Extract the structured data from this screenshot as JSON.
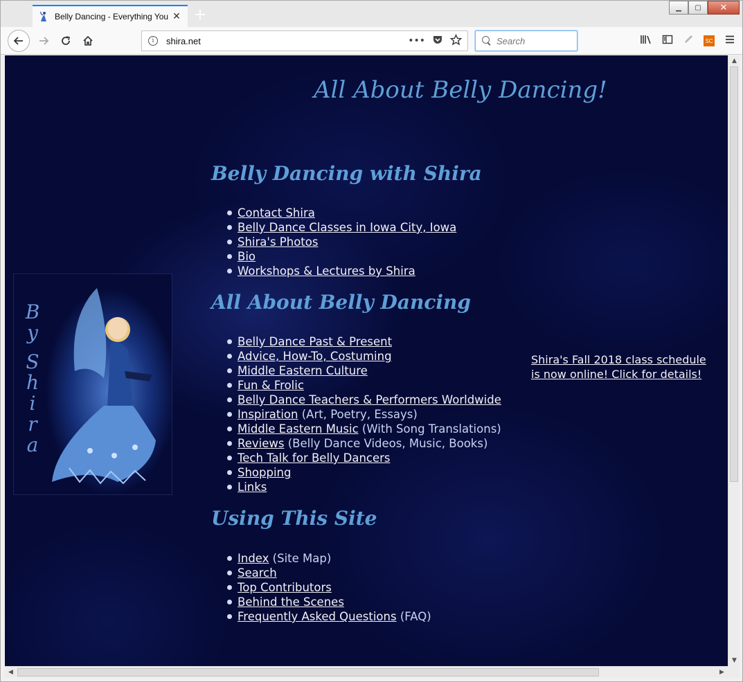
{
  "browser": {
    "tab_title": "Belly Dancing - Everything You",
    "tab_close": "✕",
    "new_tab": "+",
    "url": "shira.net",
    "search_placeholder": "Search",
    "page_actions": "•••",
    "sc_badge": "SC",
    "window_controls": {
      "minimize": "▁",
      "maximize": "▢",
      "close": "✕"
    }
  },
  "page": {
    "title": "All About Belly Dancing!",
    "photo_signature": [
      "B",
      "y",
      "S",
      "h",
      "i",
      "r",
      "a"
    ],
    "promo": "Shira's Fall 2018 class schedule is now online! Click for details!",
    "sections": [
      {
        "heading": "Belly Dancing with Shira",
        "items": [
          {
            "link": "Contact Shira",
            "note": ""
          },
          {
            "link": "Belly Dance Classes in Iowa City, Iowa",
            "note": ""
          },
          {
            "link": "Shira's Photos",
            "note": ""
          },
          {
            "link": "Bio",
            "note": ""
          },
          {
            "link": "Workshops & Lectures by Shira",
            "note": ""
          }
        ]
      },
      {
        "heading": "All About Belly Dancing",
        "items": [
          {
            "link": "Belly Dance Past & Present",
            "note": ""
          },
          {
            "link": "Advice, How-To, Costuming",
            "note": ""
          },
          {
            "link": "Middle Eastern Culture",
            "note": ""
          },
          {
            "link": "Fun & Frolic",
            "note": ""
          },
          {
            "link": "Belly Dance Teachers & Performers Worldwide",
            "note": ""
          },
          {
            "link": "Inspiration",
            "note": " (Art, Poetry, Essays)"
          },
          {
            "link": "Middle Eastern Music",
            "note": " (With Song Translations)"
          },
          {
            "link": "Reviews",
            "note": " (Belly Dance Videos, Music, Books)"
          },
          {
            "link": "Tech Talk for Belly Dancers",
            "note": ""
          },
          {
            "link": "Shopping",
            "note": ""
          },
          {
            "link": "Links",
            "note": ""
          }
        ]
      },
      {
        "heading": "Using This Site",
        "items": [
          {
            "link": "Index",
            "note": " (Site Map)"
          },
          {
            "link": "Search",
            "note": ""
          },
          {
            "link": "Top Contributors",
            "note": ""
          },
          {
            "link": "Behind the Scenes",
            "note": ""
          },
          {
            "link": "Frequently Asked Questions",
            "note": " (FAQ)"
          }
        ]
      }
    ]
  },
  "colors": {
    "page_background": "#050a36",
    "heading": "#5f9fd8",
    "link": "#f3f1f6",
    "note_text": "#c9d4f2",
    "tab_accent": "#0a84ff"
  }
}
